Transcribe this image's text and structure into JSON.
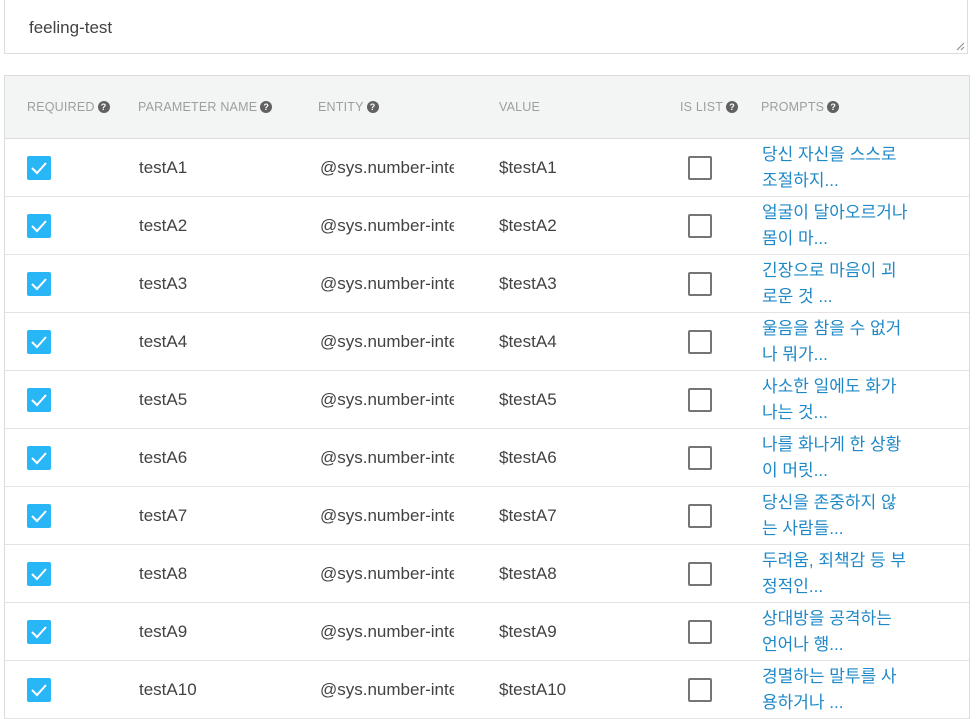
{
  "intent_field": {
    "value": "feeling-test"
  },
  "table": {
    "headers": {
      "required": "REQUIRED",
      "parameter_name": "PARAMETER NAME",
      "entity": "ENTITY",
      "value": "VALUE",
      "is_list": "IS LIST",
      "prompts": "PROMPTS"
    },
    "help_icon": "question-circle-icon",
    "checkbox_color": "#29b6f6",
    "prompt_link_color": "#1e88c8",
    "rows": [
      {
        "required": true,
        "name": "testA1",
        "entity": "@sys.number-integer",
        "value": "$testA1",
        "is_list": false,
        "prompt": "당신 자신을 스스로 조절하지..."
      },
      {
        "required": true,
        "name": "testA2",
        "entity": "@sys.number-integer",
        "value": "$testA2",
        "is_list": false,
        "prompt": "얼굴이 달아오르거나 몸이 마..."
      },
      {
        "required": true,
        "name": "testA3",
        "entity": "@sys.number-integer",
        "value": "$testA3",
        "is_list": false,
        "prompt": "긴장으로 마음이 괴로운 것 ..."
      },
      {
        "required": true,
        "name": "testA4",
        "entity": "@sys.number-integer",
        "value": "$testA4",
        "is_list": false,
        "prompt": "울음을 참을 수 없거나 뭐가..."
      },
      {
        "required": true,
        "name": "testA5",
        "entity": "@sys.number-integer",
        "value": "$testA5",
        "is_list": false,
        "prompt": "사소한 일에도 화가 나는 것..."
      },
      {
        "required": true,
        "name": "testA6",
        "entity": "@sys.number-integer",
        "value": "$testA6",
        "is_list": false,
        "prompt": "나를 화나게 한 상황이 머릿..."
      },
      {
        "required": true,
        "name": "testA7",
        "entity": "@sys.number-integer",
        "value": "$testA7",
        "is_list": false,
        "prompt": "당신을 존중하지 않는 사람들..."
      },
      {
        "required": true,
        "name": "testA8",
        "entity": "@sys.number-integer",
        "value": "$testA8",
        "is_list": false,
        "prompt": "두려움, 죄책감 등 부정적인..."
      },
      {
        "required": true,
        "name": "testA9",
        "entity": "@sys.number-integer",
        "value": "$testA9",
        "is_list": false,
        "prompt": "상대방을 공격하는 언어나 행..."
      },
      {
        "required": true,
        "name": "testA10",
        "entity": "@sys.number-integer",
        "value": "$testA10",
        "is_list": false,
        "prompt": "경멸하는 말투를 사용하거나 ..."
      }
    ]
  }
}
